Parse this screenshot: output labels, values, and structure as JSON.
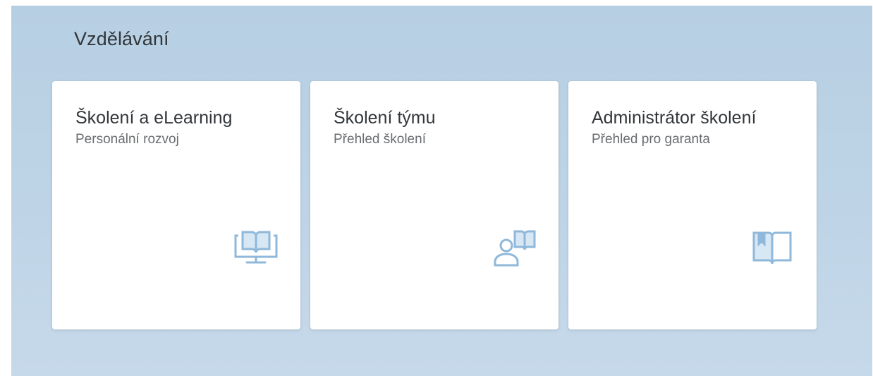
{
  "section": {
    "title": "Vzdělávání"
  },
  "tiles": [
    {
      "title": "Školení a eLearning",
      "subtitle": "Personální rozvoj",
      "icon": "monitor-book-icon"
    },
    {
      "title": "Školení týmu",
      "subtitle": "Přehled školení",
      "icon": "person-book-icon"
    },
    {
      "title": "Administrátor školení",
      "subtitle": "Přehled pro garanta",
      "icon": "open-book-bookmark-icon"
    }
  ],
  "colors": {
    "background": "#b7cfe3",
    "tile": "#ffffff",
    "icon": "#8fb8da",
    "title_text": "#32363a",
    "subtitle_text": "#6a6d70"
  }
}
